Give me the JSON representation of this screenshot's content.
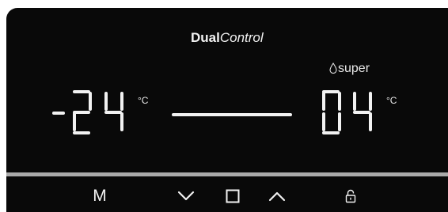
{
  "brand": {
    "bold": "Dual",
    "light": "Control"
  },
  "freezer": {
    "sign": "-",
    "digits": "24",
    "unit": "°C"
  },
  "fridge": {
    "digits": "04",
    "unit": "°C"
  },
  "super_mode": {
    "label": "super",
    "icon": "droplet-icon"
  },
  "controls": {
    "mode_label": "M",
    "down_icon": "chevron-down-icon",
    "select_icon": "square-icon",
    "up_icon": "chevron-up-icon",
    "lock_icon": "unlock-icon"
  },
  "colors": {
    "background": "#090909",
    "segment": "#f2f2f2",
    "divider": "#a9a9a9"
  }
}
